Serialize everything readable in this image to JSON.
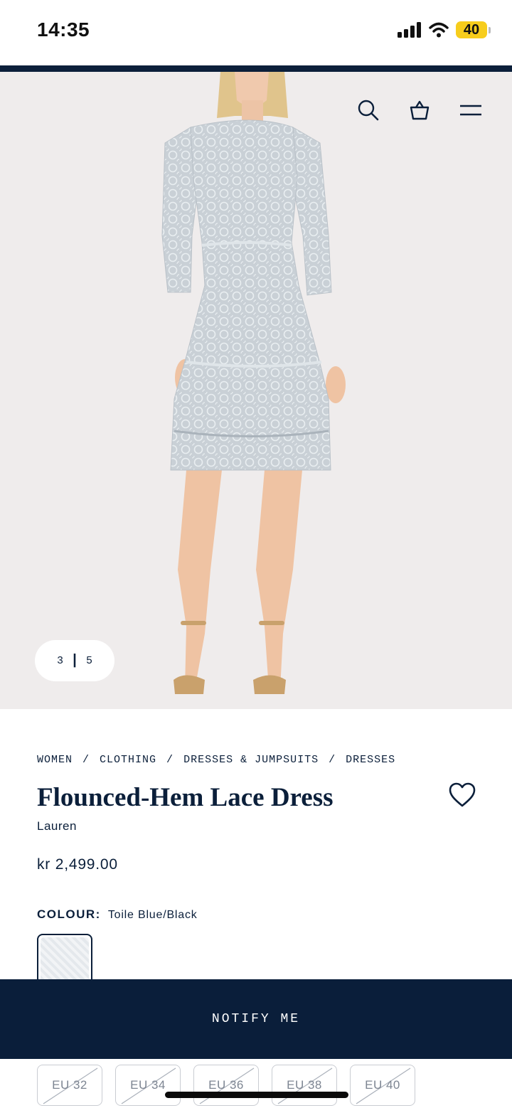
{
  "status_bar": {
    "time": "14:35",
    "battery": "40"
  },
  "gallery": {
    "current": "3",
    "separator": "|",
    "total": "5"
  },
  "breadcrumb": [
    "WOMEN",
    "/",
    "CLOTHING",
    "/",
    "DRESSES & JUMPSUITS",
    "/",
    "DRESSES"
  ],
  "product": {
    "title": "Flounced-Hem Lace Dress",
    "brand": "Lauren",
    "price": "kr 2,499.00",
    "colour_label": "COLOUR:",
    "colour_value": "Toile Blue/Black"
  },
  "actions": {
    "notify_label": "NOTIFY ME"
  },
  "sizes": [
    "EU 32",
    "EU 34",
    "EU 36",
    "EU 38",
    "EU 40"
  ],
  "colors": {
    "navy": "#0b1f3a",
    "hero_bg": "#efecec",
    "battery": "#f7cd1c"
  },
  "icons": [
    "signal-icon",
    "wifi-icon",
    "search-icon",
    "bag-icon",
    "menu-icon",
    "heart-icon"
  ]
}
